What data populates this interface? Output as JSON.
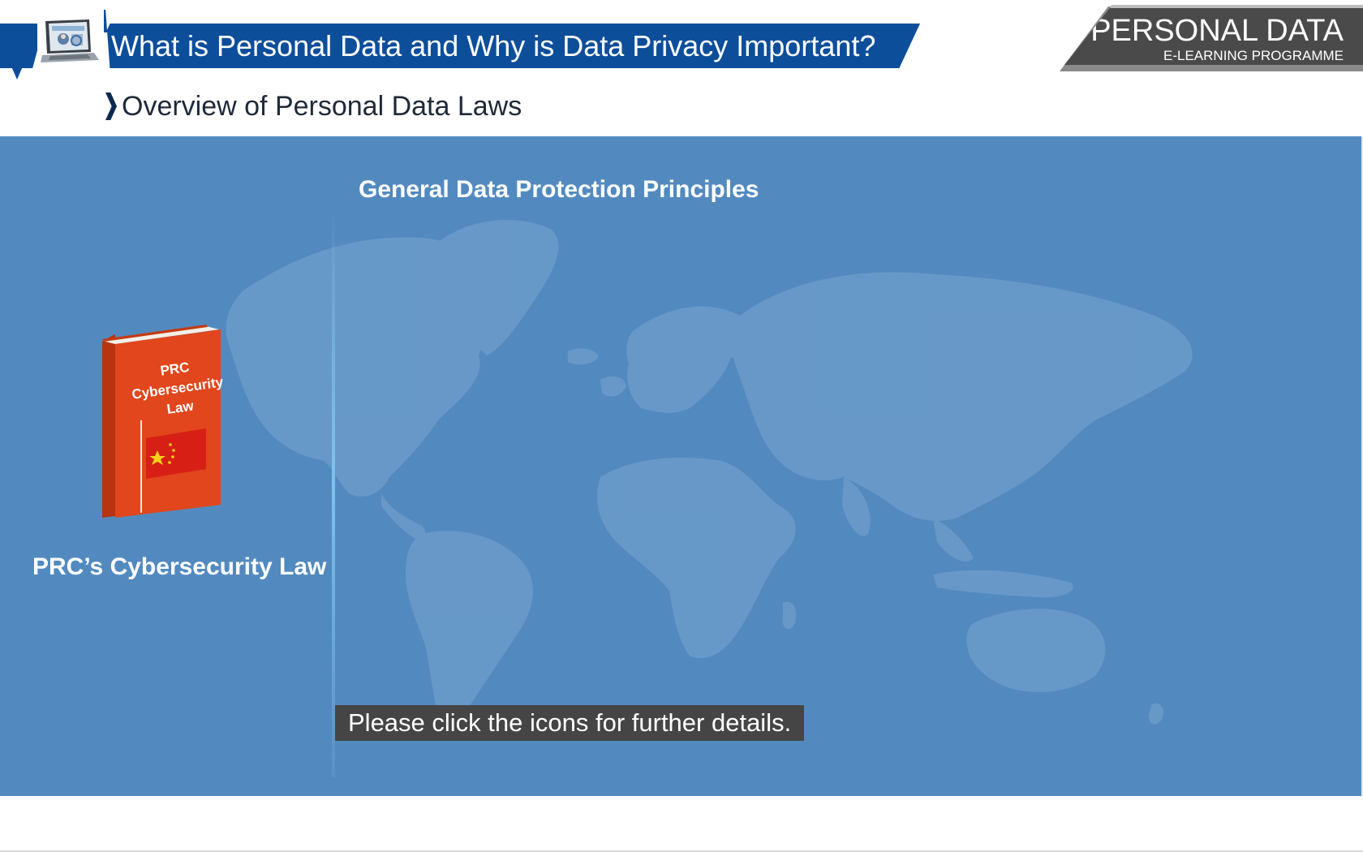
{
  "header": {
    "title": "What is Personal Data and Why is Data Privacy Important?",
    "brand_title": "PERSONAL DATA",
    "brand_subtitle": "E-LEARNING PROGRAMME",
    "section": "Overview of Personal Data Laws"
  },
  "main": {
    "heading": "General Data Protection Principles",
    "laws": [
      {
        "caption": "PRC’s Cybersecurity Law",
        "book_lines": [
          "PRC",
          "Cybersecurity",
          "Law"
        ]
      }
    ],
    "hint": "Please click the icons for further details."
  },
  "colors": {
    "banner": "#0d4e9b",
    "panel": "#528ac0",
    "map": "#6b9bc9",
    "book": "#e1461c",
    "hint_bg": "#454545"
  }
}
